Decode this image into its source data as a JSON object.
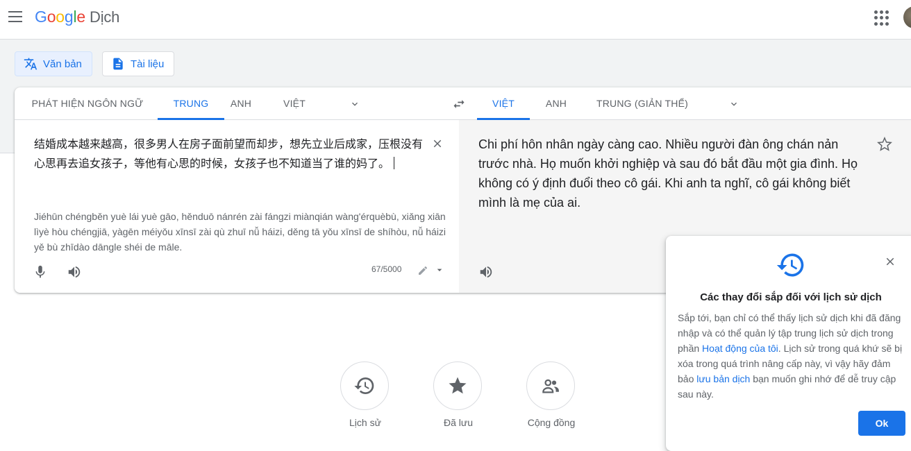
{
  "header": {
    "logo_letters": [
      "G",
      "o",
      "o",
      "g",
      "l",
      "e"
    ],
    "logo_colors": [
      "#4285f4",
      "#ea4335",
      "#fbbc05",
      "#4285f4",
      "#34a853",
      "#ea4335"
    ],
    "product": "Dịch"
  },
  "modes": {
    "text_label": "Văn bản",
    "docs_label": "Tài liệu"
  },
  "source_langs": [
    "PHÁT HIỆN NGÔN NGỮ",
    "TRUNG",
    "ANH",
    "VIỆT"
  ],
  "target_langs": [
    "VIỆT",
    "ANH",
    "TRUNG (GIẢN THỂ)"
  ],
  "source": {
    "text": "结婚成本越来越高，很多男人在房子面前望而却步，想先立业后成家，压根没有心思再去追女孩子，等他有心思的时候，女孩子也不知道当了谁的妈了。",
    "romanization": "Jiéhūn chéngběn yuè lái yuè gāo, hěnduō nánrén zài fángzi miànqián wàng'érquèbù, xiǎng xiān lìyè hòu chéngjiā, yàgēn méiyǒu xīnsī zài qù zhuī nǚ háizi, děng tā yǒu xīnsī de shíhòu, nǚ háizi yě bù zhīdào dāngle shéi de māle.",
    "counter": "67/5000"
  },
  "target": {
    "text": "Chi phí hôn nhân ngày càng cao. Nhiều người đàn ông chán nản trước nhà. Họ muốn khởi nghiệp và sau đó bắt đầu một gia đình. Họ không có ý định đuổi theo cô gái. Khi anh ta nghĩ, cô gái không biết mình là mẹ của ai."
  },
  "bottom_buttons": {
    "history": "Lịch sử",
    "saved": "Đã lưu",
    "community": "Cộng đồng"
  },
  "popup": {
    "title": "Các thay đổi sắp đối với lịch sử dịch",
    "body_1": "Sắp tới, bạn chỉ có thể thấy lịch sử dịch khi đã đăng nhập và có thể quản lý tập trung lịch sử dịch trong phần ",
    "link_1": "Hoạt động của tôi",
    "body_2": ". Lịch sử trong quá khứ sẽ bị xóa trong quá trình nâng cấp này, vì vậy hãy đảm bảo ",
    "link_2": "lưu bản dịch",
    "body_3": " bạn muốn ghi nhớ để dễ truy cập sau này.",
    "ok": "Ok"
  }
}
